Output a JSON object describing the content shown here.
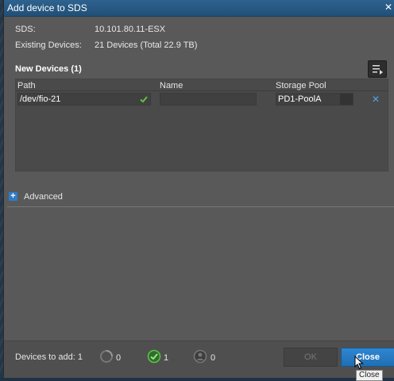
{
  "dialog": {
    "title": "Add device to SDS",
    "close_glyph": "✕"
  },
  "info": {
    "sds_label": "SDS:",
    "sds_value": "10.101.80.11-ESX",
    "existing_label": "Existing Devices:",
    "existing_value": "21 Devices (Total 22.9 TB)"
  },
  "new_devices": {
    "title": "New Devices (1)",
    "columns": [
      "Path",
      "Name",
      "Storage Pool"
    ],
    "rows": [
      {
        "path": "/dev/fio-21",
        "name": "",
        "storage_pool": "PD1-PoolA"
      }
    ],
    "remove_glyph": "✕"
  },
  "advanced": {
    "toggle_glyph": "+",
    "label": "Advanced"
  },
  "footer": {
    "devices_to_add_label": "Devices to add: 1",
    "pending_count": "0",
    "success_count": "1",
    "failed_count": "0",
    "ok_label": "OK",
    "close_label": "Close"
  },
  "tooltip": "Close",
  "colors": {
    "titlebar": "#215077",
    "accent": "#1f6fb5",
    "success": "#5fc24a"
  },
  "icons": {
    "valid": "check-icon",
    "remove": "close-icon",
    "collapse": "collapse-panel-icon",
    "pending": "spinner-icon",
    "success": "check-circle-icon",
    "failed": "error-circle-icon"
  }
}
